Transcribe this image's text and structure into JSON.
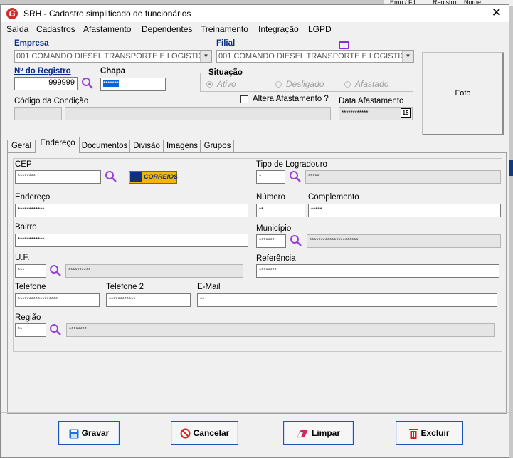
{
  "background": {
    "col1": "Emp / Fil",
    "col2": "Registro",
    "col3": "Nome"
  },
  "window": {
    "title": "SRH - Cadastro simplificado de funcionários",
    "accent": "#1a58b8"
  },
  "menu": [
    "Saída",
    "Cadastros",
    "Afastamento",
    "Dependentes",
    "Treinamento",
    "Integração",
    "LGPD"
  ],
  "header": {
    "empresa_label": "Empresa",
    "empresa_value": "001 COMANDO DIESEL TRANSPORTE E LOGISTIC.",
    "filial_label": "Filial",
    "filial_value": "001 COMANDO DIESEL TRANSPORTE E LOGISTIC.",
    "registro_label": "Nº do Registro",
    "registro_value": "999999",
    "chapa_label": "Chapa",
    "chapa_value": "*******",
    "situacao_label": "Situação",
    "situacao_options": [
      "Ativo",
      "Desligado",
      "Afastado"
    ],
    "situacao_selected": "Ativo",
    "codigo_condicao_label": "Código da Condição",
    "altera_label": "Altera Afastamento ?",
    "data_afastamento_label": "Data Afastamento",
    "data_afastamento_value": "************",
    "calendar_day": "15",
    "foto_label": "Foto"
  },
  "tabs": [
    "Geral",
    "Endereço",
    "Documentos",
    "Divisão",
    "Imagens",
    "Grupos"
  ],
  "active_tab": "Endereço",
  "endereco": {
    "cep_label": "CEP",
    "cep_value": "********",
    "correios_label": "CORREIOS",
    "tipo_logradouro_label": "Tipo de Logradouro",
    "tipo_code": "*",
    "tipo_desc": "*****",
    "endereco_label": "Endereço",
    "endereco_value": "************",
    "numero_label": "Número",
    "numero_value": "**",
    "complemento_label": "Complemento",
    "complemento_value": "*****",
    "bairro_label": "Bairro",
    "bairro_value": "************",
    "municipio_label": "Município",
    "municipio_code": "*******",
    "municipio_desc": "**********************",
    "uf_label": "U.F.",
    "uf_code": "***",
    "uf_desc": "**********",
    "referencia_label": "Referência",
    "referencia_value": "********",
    "telefone_label": "Telefone",
    "telefone_value": "******************",
    "telefone2_label": "Telefone 2",
    "telefone2_value": "************",
    "email_label": "E-Mail",
    "email_value": "**",
    "regiao_label": "Região",
    "regiao_code": "**",
    "regiao_desc": "********"
  },
  "buttons": {
    "gravar": "Gravar",
    "cancelar": "Cancelar",
    "limpar": "Limpar",
    "excluir": "Excluir"
  }
}
